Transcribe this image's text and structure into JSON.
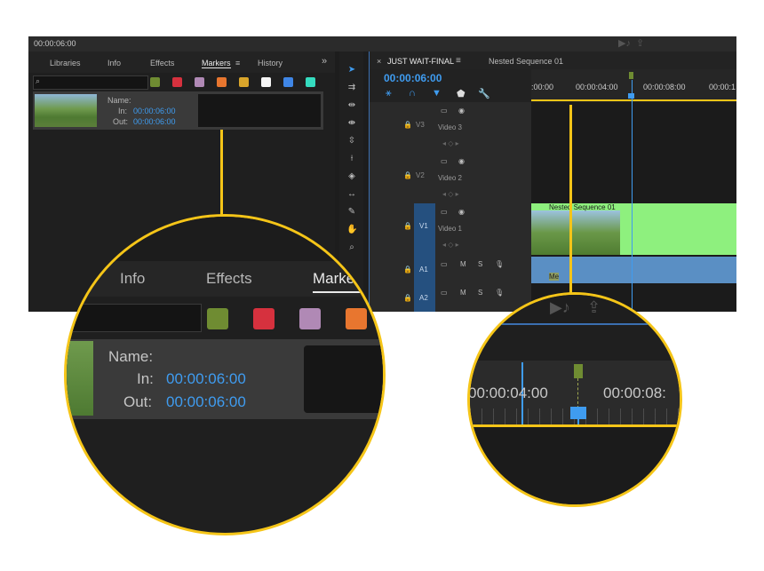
{
  "app": {
    "top_timecode": "00:00:06:00"
  },
  "left_panel": {
    "tabs": [
      {
        "label": "Libraries"
      },
      {
        "label": "Info"
      },
      {
        "label": "Effects"
      },
      {
        "label": "Markers"
      },
      {
        "label": "History"
      }
    ],
    "active_tab": "Markers",
    "more_label": "»",
    "marker_colors": [
      "#6f8c32",
      "#d6313e",
      "#b089b5",
      "#e8762f",
      "#d9a52b",
      "#f5f5f5",
      "#3f86e6",
      "#35dcc0"
    ],
    "marker": {
      "name_label": "Name:",
      "in_label": "In:",
      "in_value": "00:00:06:00",
      "out_label": "Out:",
      "out_value": "00:00:06:00"
    }
  },
  "timeline": {
    "tab_active": "JUST WAIT-FINAL",
    "tab_other": "Nested Sequence 01",
    "close_glyph": "×",
    "menu_glyph": "≡",
    "timecode": "00:00:06:00",
    "ruler_labels": [
      ":00:00",
      "00:00:04:00",
      "00:00:08:00",
      "00:00:1"
    ],
    "tracks": [
      {
        "id": "V3",
        "name": "Video 3"
      },
      {
        "id": "V2",
        "name": "Video 2"
      },
      {
        "id": "V1",
        "name": "Video 1"
      },
      {
        "id": "A1",
        "name": ""
      },
      {
        "id": "A2",
        "name": ""
      }
    ],
    "clip_label": "Nested Sequence 01",
    "audio_letters": {
      "m": "M",
      "s": "S"
    },
    "audio_clip_tag": "Me"
  },
  "zoom_left": {
    "tabs": [
      "Info",
      "Effects",
      "Marke"
    ],
    "colors": [
      "#6f8c32",
      "#d6313e",
      "#b089b5",
      "#e8762f"
    ],
    "name_label": "Name:",
    "in_label": "In:",
    "in_value": "00:00:06:00",
    "out_label": "Out:",
    "out_value": "00:00:06:00"
  },
  "zoom_right": {
    "label_a": "00:00:04:00",
    "label_b": "00:00:08:"
  },
  "accent": "#f5c518"
}
